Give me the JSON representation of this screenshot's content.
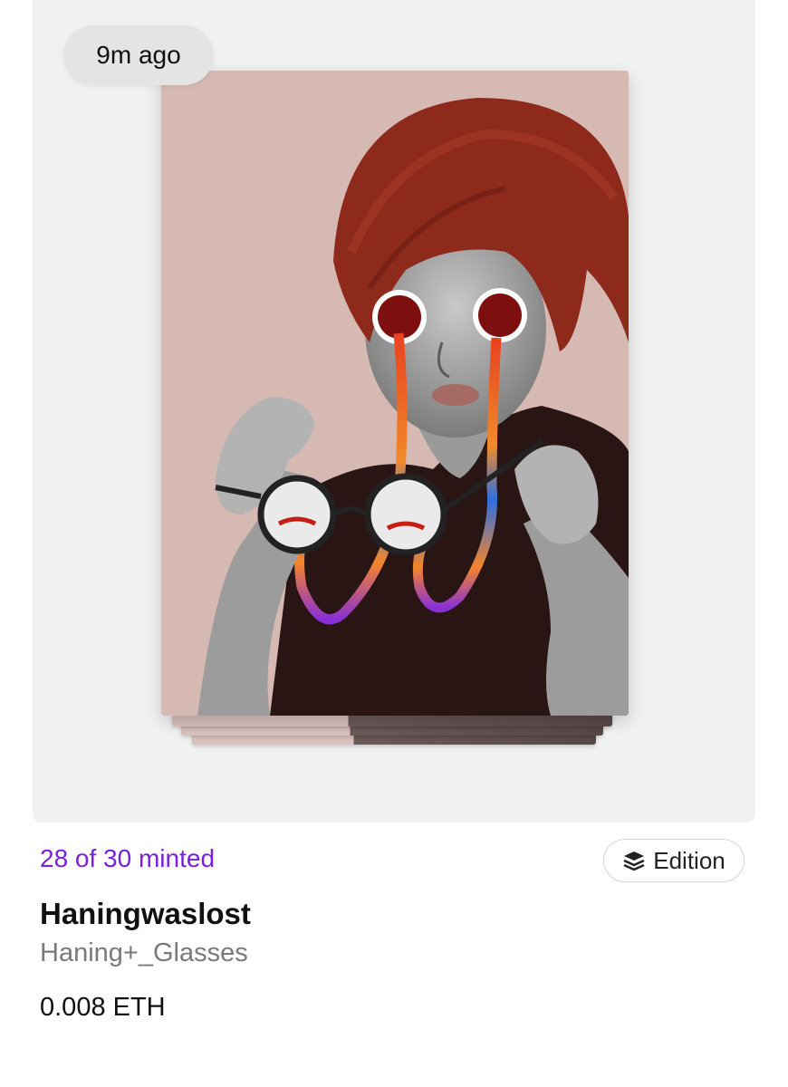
{
  "card": {
    "timestamp": "9m ago",
    "artwork": {
      "description_icon": "artwork-image"
    }
  },
  "info": {
    "minted_text": "28 of 30 minted",
    "badge_label": "Edition",
    "badge_icon": "layers-icon",
    "artist": "Haningwaslost",
    "title": "Haning+_Glasses",
    "price": "0.008 ETH"
  },
  "colors": {
    "minted": "#7b1fe0",
    "background_panel": "#f1f1f1",
    "artwork_bg": "#d7b9b3"
  }
}
